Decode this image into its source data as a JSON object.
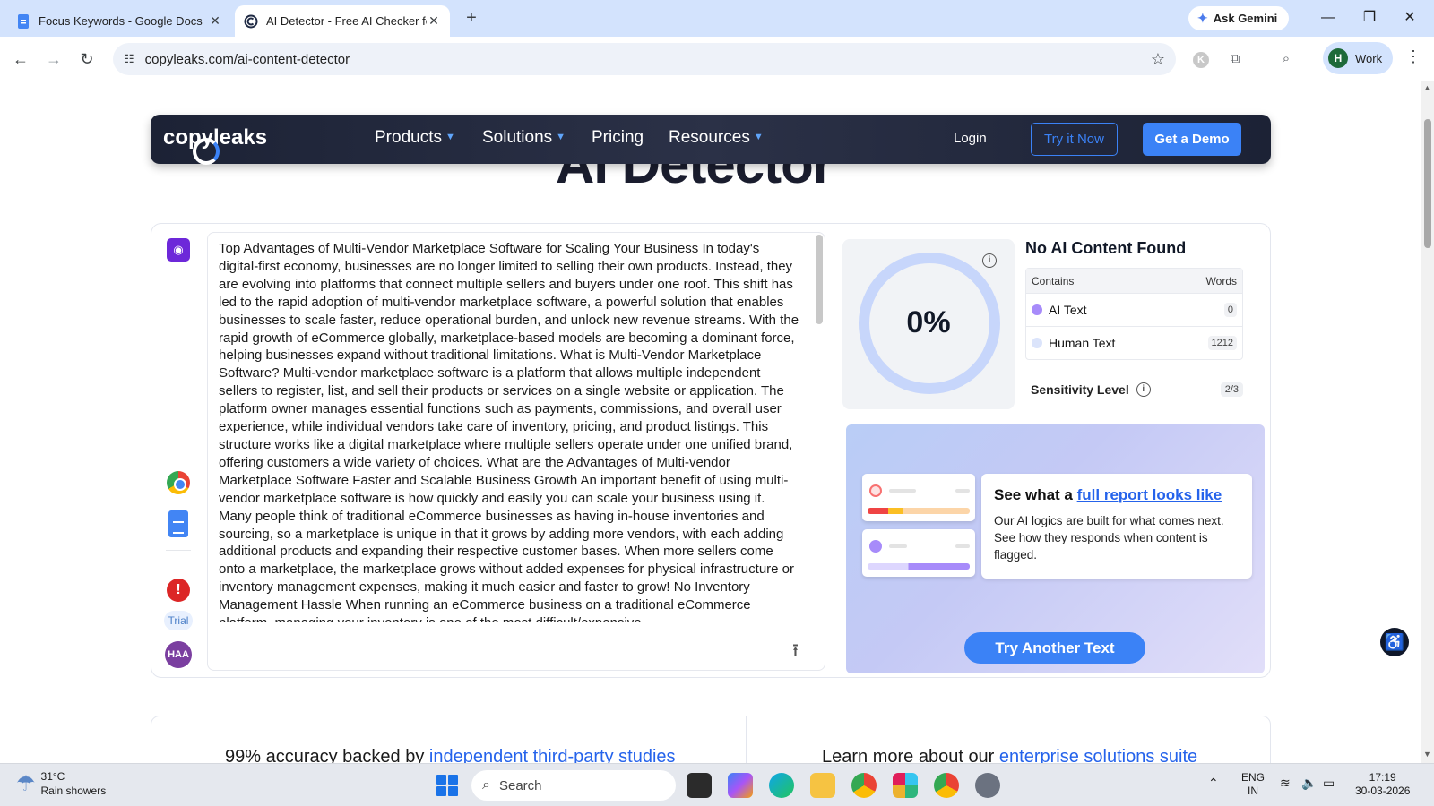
{
  "browser": {
    "tabs": [
      {
        "title": "Focus Keywords - Google Docs",
        "active": false
      },
      {
        "title": "AI Detector - Free AI Checker fo",
        "active": true
      }
    ],
    "new_tab": "+",
    "ask_gemini": "Ask Gemini",
    "url": "copyleaks.com/ai-content-detector",
    "profile_initial": "H",
    "profile_label": "Work",
    "extension_initial": "K"
  },
  "site_nav": {
    "logo": "copyleaks",
    "menu": [
      {
        "label": "Products",
        "dropdown": true
      },
      {
        "label": "Solutions",
        "dropdown": true
      },
      {
        "label": "Pricing",
        "dropdown": false
      },
      {
        "label": "Resources",
        "dropdown": true
      }
    ],
    "login": "Login",
    "try_now": "Try it Now",
    "get_demo": "Get a Demo"
  },
  "page_title": "AI Detector",
  "rail": {
    "trial": "Trial",
    "user_initials": "HAA",
    "alert": "!"
  },
  "input_text": "Top Advantages of Multi-Vendor Marketplace Software for Scaling Your Business In today's digital-first economy, businesses are no longer limited to selling their own products. Instead, they are evolving into platforms that connect multiple sellers and buyers under one roof. This shift has led to the rapid adoption of multi-vendor marketplace software, a powerful solution that enables businesses to scale faster, reduce operational burden, and unlock new revenue streams. With the rapid growth of eCommerce globally, marketplace-based models are becoming a dominant force, helping businesses expand without traditional limitations. What is Multi-Vendor Marketplace Software? Multi-vendor marketplace software is a platform that allows multiple independent sellers to register, list, and sell their products or services on a single website or application. The platform owner manages essential functions such as payments, commissions, and overall user experience, while individual vendors take care of inventory, pricing, and product listings. This structure works like a digital marketplace where multiple sellers operate under one unified brand, offering customers a wide variety of choices. What are the Advantages of Multi-vendor Marketplace Software Faster and Scalable Business Growth An important benefit of using multi-vendor marketplace software is how quickly and easily you can scale your business using it. Many people think of traditional eCommerce businesses as having in-house inventories and sourcing, so a marketplace is unique in that it grows by adding more vendors, with each adding additional products and expanding their respective customer bases. When more sellers come onto a marketplace, the marketplace grows without added expenses for physical infrastructure or inventory management expenses, making it much easier and faster to grow! No Inventory Management Hassle When running an eCommerce business on a traditional eCommerce platform, managing your inventory is one of the most difficult/expensive",
  "result": {
    "ai_percentage": "0%",
    "ai_fraction": 0,
    "heading": "No AI Content Found",
    "table_headers": {
      "contains": "Contains",
      "words": "Words"
    },
    "rows": [
      {
        "label": "AI Text",
        "count": "0",
        "color": "#a78bfa"
      },
      {
        "label": "Human Text",
        "count": "1212",
        "color": "#dbe4fb"
      }
    ],
    "sensitivity_label": "Sensitivity Level",
    "sensitivity_value": "2/3",
    "ring_color": "#c7d6fb"
  },
  "promo": {
    "heading_prefix": "See what a ",
    "heading_link": "full report looks like",
    "body": "Our AI logics are built for what comes next. See how they responds when content is flagged.",
    "button": "Try Another Text"
  },
  "bottom": {
    "left_prefix": "99% accuracy backed by ",
    "left_link": "independent third-party studies",
    "right_prefix": "Learn more about our ",
    "right_link": "enterprise solutions suite"
  },
  "taskbar": {
    "temperature": "31°C",
    "weather": "Rain showers",
    "search_placeholder": "Search",
    "language": "ENG",
    "region": "IN",
    "time": "17:19",
    "date": "30-03-2026"
  },
  "colors": {
    "accent": "#3b82f6",
    "nav_bg": "#1c2235",
    "promo_bg": "#c4c9f5"
  }
}
